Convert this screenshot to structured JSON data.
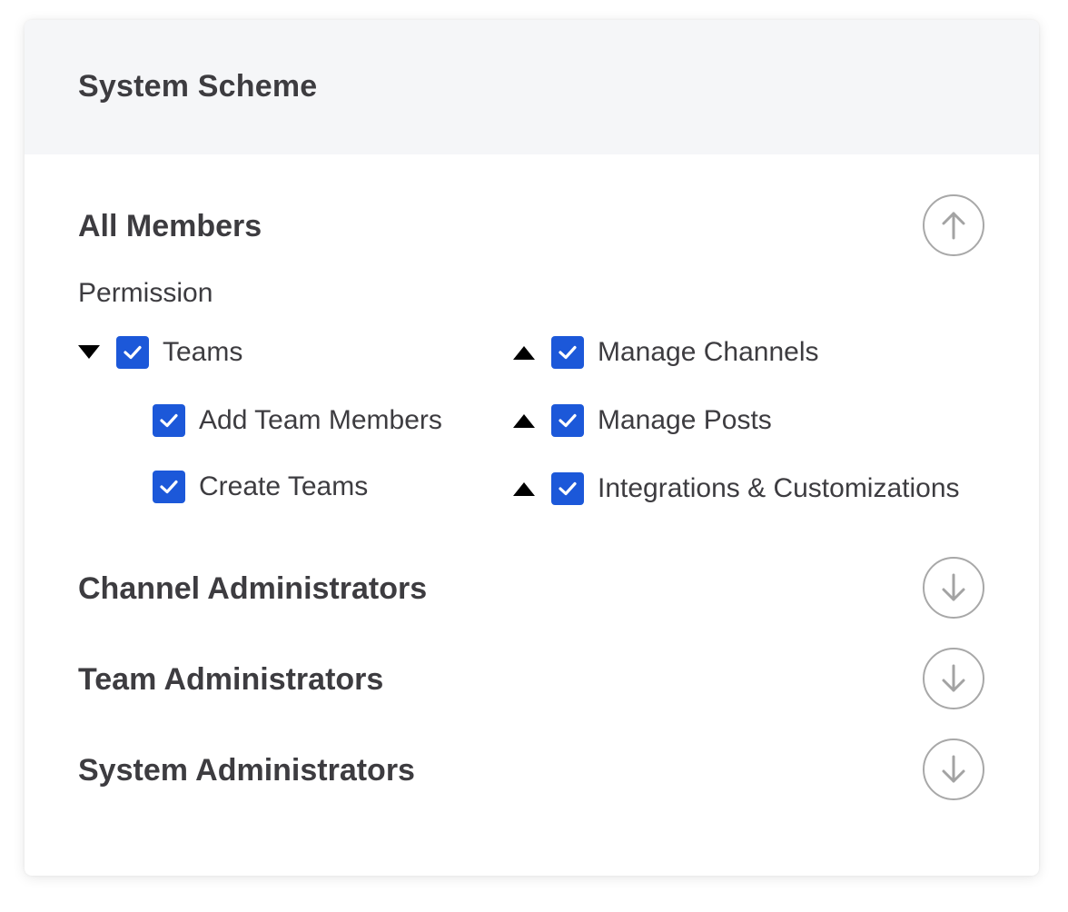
{
  "card": {
    "title": "System Scheme"
  },
  "sections": {
    "all_members": {
      "title": "All Members",
      "expanded": true,
      "permission_label": "Permission",
      "left_column": {
        "teams": {
          "label": "Teams",
          "checked": true,
          "caret": "down"
        },
        "add_team_members": {
          "label": "Add Team Members",
          "checked": true
        },
        "create_teams": {
          "label": "Create Teams",
          "checked": true
        }
      },
      "right_column": {
        "manage_channels": {
          "label": "Manage Channels",
          "checked": true,
          "caret": "up"
        },
        "manage_posts": {
          "label": "Manage Posts",
          "checked": true,
          "caret": "up"
        },
        "integrations": {
          "label": "Integrations & Customizations",
          "checked": true,
          "caret": "up"
        }
      }
    },
    "channel_admins": {
      "title": "Channel Administrators",
      "expanded": false
    },
    "team_admins": {
      "title": "Team Administrators",
      "expanded": false
    },
    "system_admins": {
      "title": "System Administrators",
      "expanded": false
    }
  },
  "icons": {
    "collapse": "arrow-up-icon",
    "expand": "arrow-down-icon",
    "checked": "checkmark-icon"
  },
  "colors": {
    "checkbox": "#1c58d9",
    "header_bg": "#f5f6f8",
    "text": "#3d3c40",
    "button_border": "#a8a8a8"
  }
}
